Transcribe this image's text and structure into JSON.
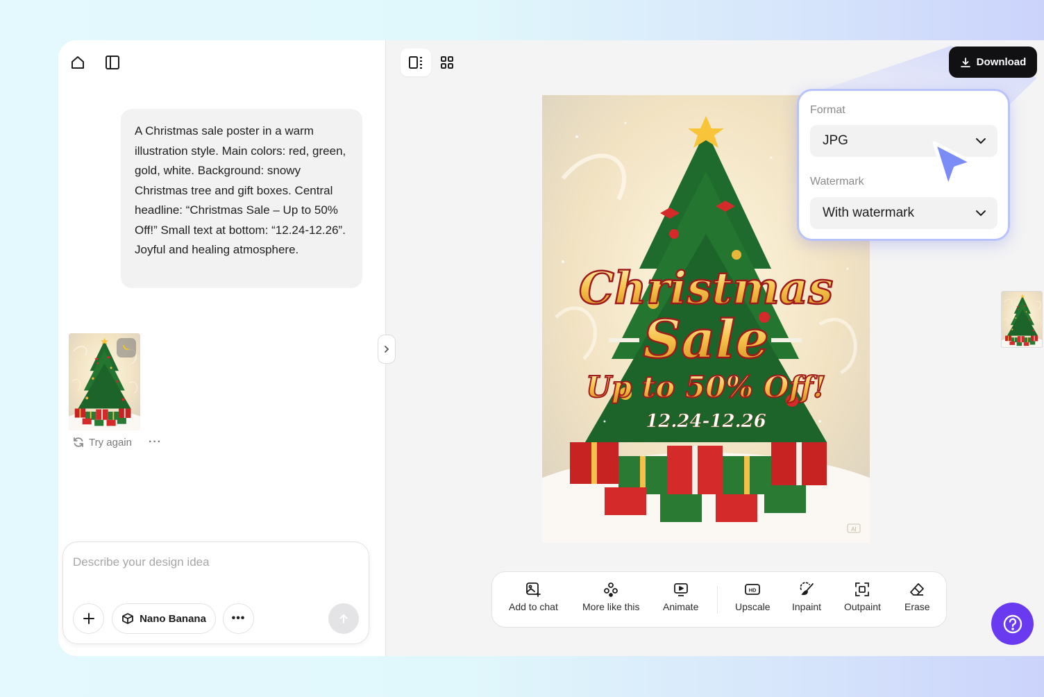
{
  "sidebar": {
    "prompt_text": "A Christmas sale poster in a warm illustration style. Main colors: red, green, gold, white. Background: snowy Christmas tree and gift boxes. Central headline: “Christmas Sale – Up to 50% Off!” Small text at bottom: “12.24-12.26”. Joyful and healing atmosphere.",
    "try_again_label": "Try again",
    "more_label": "···"
  },
  "composer": {
    "placeholder": "Describe your design idea",
    "model_label": "Nano Banana"
  },
  "poster": {
    "line1": "Christmas",
    "line2": "Sale",
    "line3": "Up to 50% Off!",
    "date": "12.24-12.26",
    "ai_mark": "AI"
  },
  "toolbar": {
    "tools": [
      {
        "label": "Add to chat",
        "icon": "image-add-icon"
      },
      {
        "label": "More like this",
        "icon": "variations-icon"
      },
      {
        "label": "Animate",
        "icon": "play-frame-icon"
      },
      {
        "label": "Upscale",
        "icon": "hd-icon"
      },
      {
        "label": "Inpaint",
        "icon": "brush-icon"
      },
      {
        "label": "Outpaint",
        "icon": "expand-icon"
      },
      {
        "label": "Erase",
        "icon": "eraser-icon"
      }
    ]
  },
  "download": {
    "button_label": "Download",
    "format_label": "Format",
    "format_value": "JPG",
    "watermark_label": "Watermark",
    "watermark_value": "With watermark"
  },
  "colors": {
    "accent": "#6a3af0",
    "panel_border": "#b9c3fb",
    "cursor": "#7b8cf7",
    "download_bg": "#111114"
  }
}
